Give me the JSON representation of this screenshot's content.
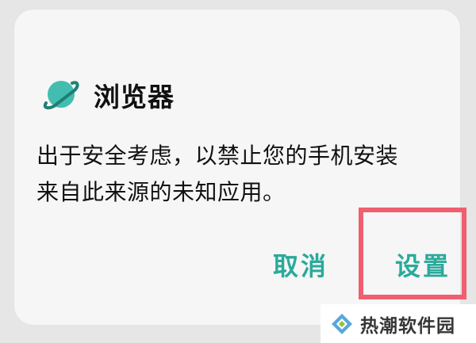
{
  "dialog": {
    "app_name": "浏览器",
    "app_icon": "planet-icon",
    "message_line1": "出于安全考虑，以禁止您的手机安装",
    "message_line2": "来自此来源的未知应用。",
    "cancel_label": "取消",
    "settings_label": "设置"
  },
  "watermark": {
    "text": "热潮软件园",
    "logo_icon": "diamond-logo-icon"
  },
  "colors": {
    "accent": "#2aaa9b",
    "highlight": "#ef5f6f",
    "dialog_bg": "#f6f6f6",
    "page_bg": "#e6e6e6"
  }
}
